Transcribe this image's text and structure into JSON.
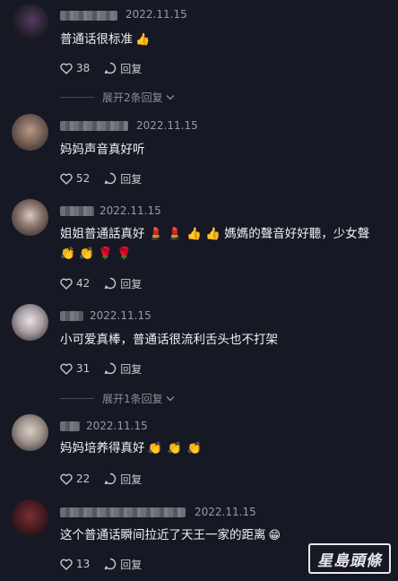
{
  "comments": [
    {
      "date": "2022.11.15",
      "text": "普通话很标准",
      "emojis": [
        "👍"
      ],
      "likes": "38",
      "reply": "回复"
    },
    {
      "date": "2022.11.15",
      "text": "妈妈声音真好听",
      "emojis": [],
      "likes": "52",
      "reply": "回复"
    },
    {
      "date": "2022.11.15",
      "text": "姐姐普通話真好 💄 💄 👍 👍 媽媽的聲音好好聽，少女聲 👏 👏 🌹 🌹",
      "likes": "42",
      "reply": "回复"
    },
    {
      "date": "2022.11.15",
      "text": "小可爱真棒，普通话很流利舌头也不打架",
      "emojis": [],
      "likes": "31",
      "reply": "回复"
    },
    {
      "date": "2022.11.15",
      "text": "妈妈培养得真好",
      "emojis": [
        "👏",
        "👏",
        "👏"
      ],
      "likes": "22",
      "reply": "回复"
    },
    {
      "date": "2022.11.15",
      "text": "这个普通话瞬间拉近了天王一家的距离",
      "emojis": [
        "😁"
      ],
      "likes": "13",
      "reply": "回复"
    }
  ],
  "expand_replies": [
    {
      "label": "展开2条回复"
    },
    {
      "label": "展开1条回复"
    }
  ],
  "watermark": "星島頭條",
  "colors": {
    "background": "#161823",
    "text": "#f1f1f3",
    "muted": "#9a9ba3"
  }
}
